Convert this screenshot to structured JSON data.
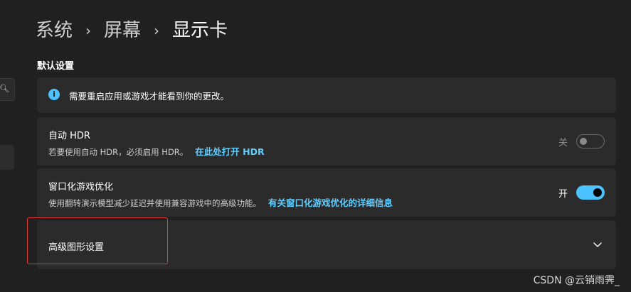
{
  "breadcrumb": {
    "items": [
      "系统",
      "屏幕",
      "显示卡"
    ],
    "separator": "›"
  },
  "section_title": "默认设置",
  "sidebar": {
    "search_icon": "search-icon"
  },
  "info_banner": {
    "icon": "info-icon",
    "text": "需要重启应用或游戏才能看到你的更改。"
  },
  "auto_hdr": {
    "title": "自动 HDR",
    "description": "若要使用自动 HDR，必须启用 HDR。",
    "link": "在此处打开 HDR",
    "toggle_label": "关",
    "toggle_state": "off"
  },
  "windowed_games": {
    "title": "窗口化游戏优化",
    "description": "使用翻转演示模型减少延迟并使用兼容游戏中的高级功能。",
    "link": "有关窗口化游戏优化的详细信息",
    "toggle_label": "开",
    "toggle_state": "on"
  },
  "advanced_graphics": {
    "title": "高级图形设置",
    "icon": "chevron-down-icon"
  },
  "watermark": "CSDN @云销雨霁_",
  "colors": {
    "accent": "#4cc2ff",
    "link": "#60cdff",
    "highlight": "#e53935",
    "background": "#202020",
    "card": "#2b2b2b"
  }
}
